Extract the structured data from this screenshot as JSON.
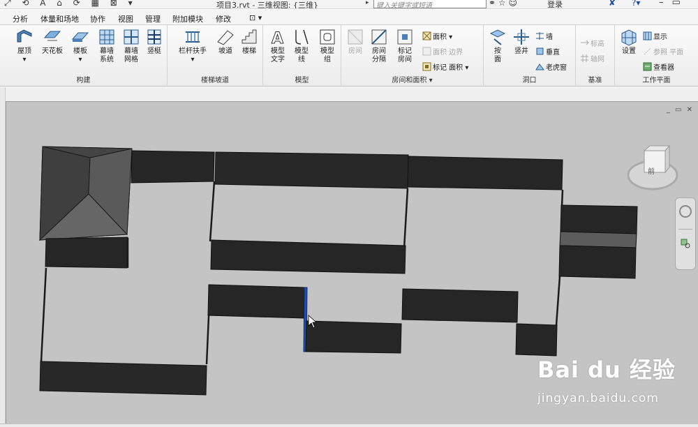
{
  "titlebar": {
    "doc_title": "项目3.rvt - 三维视图: {三维}",
    "search_placeholder": "键入关键字或短语",
    "login": "登录"
  },
  "menu": {
    "tabs": [
      {
        "label": "分析"
      },
      {
        "label": "体量和场地"
      },
      {
        "label": "协作"
      },
      {
        "label": "视图"
      },
      {
        "label": "管理"
      },
      {
        "label": "附加模块"
      },
      {
        "label": "修改"
      }
    ],
    "extra_tab": "⊡ ▾"
  },
  "ribbon": {
    "panels": {
      "build": "构建",
      "stairs": "楼梯坡道",
      "model": "模型",
      "room": "房间和面积 ▾",
      "opening": "洞口",
      "datum": "基准",
      "workplane": "工作平面"
    },
    "build_tools": [
      {
        "label": "屋顶",
        "sub": "▾"
      },
      {
        "label": "天花板",
        "sub": ""
      },
      {
        "label": "楼板",
        "sub": "▾"
      },
      {
        "label": "幕墙",
        "sub": "系统"
      },
      {
        "label": "幕墙",
        "sub": "网格"
      },
      {
        "label": "竖梃",
        "sub": ""
      }
    ],
    "stairs_tools": [
      {
        "label": "栏杆扶手",
        "sub": "▾"
      },
      {
        "label": "坡道",
        "sub": ""
      },
      {
        "label": "楼梯",
        "sub": ""
      }
    ],
    "model_tools": [
      {
        "label": "模型",
        "sub": "文字"
      },
      {
        "label": "模型",
        "sub": "线"
      },
      {
        "label": "模型",
        "sub": "组"
      }
    ],
    "room_tools": [
      {
        "label": "房间",
        "sub": ""
      },
      {
        "label": "房间",
        "sub": "分隔"
      },
      {
        "label": "标记",
        "sub": "房间"
      }
    ],
    "room_small": [
      {
        "label": "面积 ▾"
      },
      {
        "label": "面积 边界"
      },
      {
        "label": "标记 面积 ▾"
      }
    ],
    "opening_tools": [
      {
        "label": "按",
        "sub": "面"
      },
      {
        "label": "竖井",
        "sub": ""
      }
    ],
    "opening_small": [
      {
        "label": "墙"
      },
      {
        "label": "垂直"
      },
      {
        "label": "老虎窗"
      }
    ],
    "datum_small": [
      {
        "label": "标高"
      },
      {
        "label": "轴网"
      }
    ],
    "workplane_tool": {
      "label": "设置"
    },
    "workplane_small": [
      {
        "label": "显示"
      },
      {
        "label": "参照 平面"
      },
      {
        "label": "查看器"
      }
    ]
  },
  "viewcube": {
    "face": "前"
  },
  "viewport_controls": "_ ▭ ✕",
  "watermark": {
    "logo": "Bai du 经验",
    "url": "jingyan.baidu.com"
  },
  "colors": {
    "canvas": "#c4c4c4",
    "wall_top": "#2d2d2d",
    "wall_face": "#2a2a2a",
    "roof": "#555555",
    "highlight": "#1e4fb0"
  }
}
